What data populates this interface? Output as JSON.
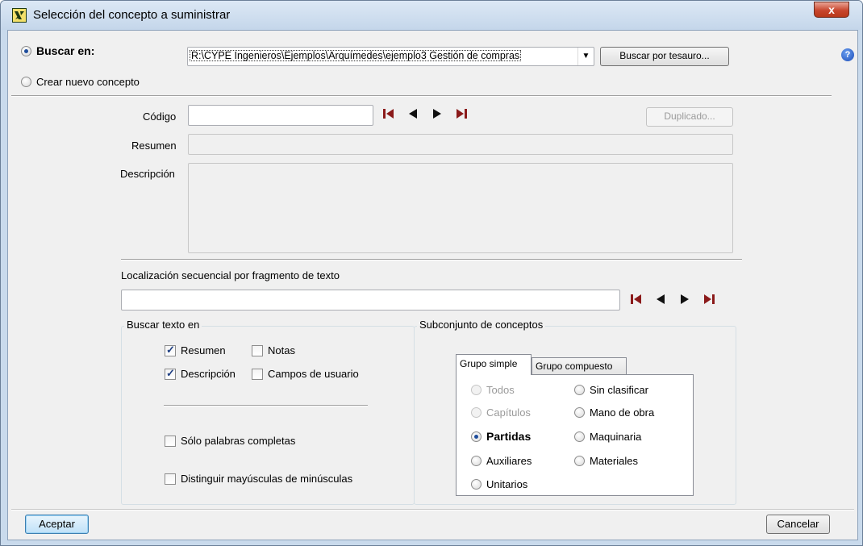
{
  "window": {
    "title": "Selección del concepto a suministrar",
    "close_glyph": "x"
  },
  "top": {
    "buscar_en_label": "Buscar en:",
    "path_value": "R:\\CYPE Ingenieros\\Ejemplos\\Arquímedes\\ejemplo3 Gestión de compras",
    "buscar_tesauro_label": "Buscar por tesauro...",
    "crear_nuevo_label": "Crear nuevo concepto",
    "selected_mode": "Buscar en:"
  },
  "form": {
    "codigo_label": "Código",
    "codigo_value": "",
    "duplicado_label": "Duplicado...",
    "resumen_label": "Resumen",
    "resumen_value": "",
    "descripcion_label": "Descripción",
    "descripcion_value": ""
  },
  "search": {
    "localizacion_label": "Localización secuencial por fragmento de texto",
    "text_value": ""
  },
  "buscar_texto": {
    "title": "Buscar texto en",
    "resumen": {
      "label": "Resumen",
      "checked": true
    },
    "notas": {
      "label": "Notas",
      "checked": false
    },
    "descripcion": {
      "label": "Descripción",
      "checked": true
    },
    "campos_usuario": {
      "label": "Campos de usuario",
      "checked": false
    },
    "solo_palabras": {
      "label": "Sólo palabras completas",
      "checked": false
    },
    "distinguir": {
      "label": "Distinguir mayúsculas de minúsculas",
      "checked": false
    }
  },
  "subconjunto": {
    "title": "Subconjunto de conceptos",
    "tabs": [
      {
        "label": "Grupo simple",
        "active": true
      },
      {
        "label": "Grupo compuesto",
        "active": false
      }
    ],
    "options_left": [
      {
        "label": "Todos",
        "enabled": false,
        "selected": false
      },
      {
        "label": "Capítulos",
        "enabled": false,
        "selected": false
      },
      {
        "label": "Partidas",
        "enabled": true,
        "selected": true
      },
      {
        "label": "Auxiliares",
        "enabled": true,
        "selected": false
      },
      {
        "label": "Unitarios",
        "enabled": true,
        "selected": false
      }
    ],
    "options_right": [
      {
        "label": "Sin clasificar",
        "enabled": true,
        "selected": false
      },
      {
        "label": "Mano de obra",
        "enabled": true,
        "selected": false
      },
      {
        "label": "Maquinaria",
        "enabled": true,
        "selected": false
      },
      {
        "label": "Materiales",
        "enabled": true,
        "selected": false
      }
    ]
  },
  "footer": {
    "aceptar_label": "Aceptar",
    "cancelar_label": "Cancelar"
  },
  "icons": {
    "nav_color": "#8b1a1a",
    "help": "?"
  }
}
